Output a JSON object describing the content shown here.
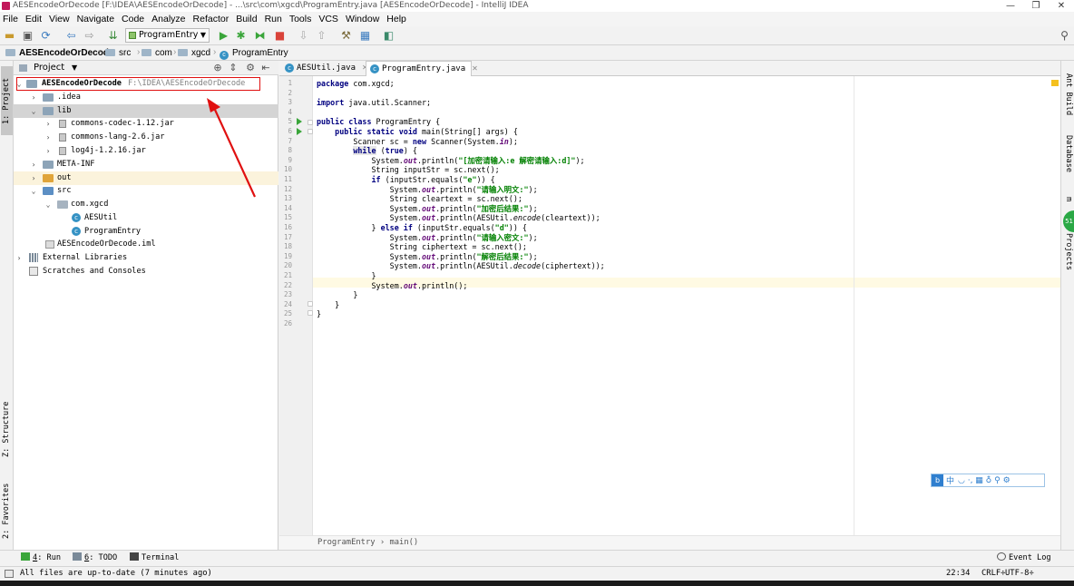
{
  "window": {
    "title": "AESEncodeOrDecode [F:\\IDEA\\AESEncodeOrDecode] - ...\\src\\com\\xgcd\\ProgramEntry.java [AESEncodeOrDecode] - IntelliJ IDEA",
    "minimize": "—",
    "maximize": "❐",
    "close": "✕"
  },
  "menu": [
    "File",
    "Edit",
    "View",
    "Navigate",
    "Code",
    "Analyze",
    "Refactor",
    "Build",
    "Run",
    "Tools",
    "VCS",
    "Window",
    "Help"
  ],
  "toolbar": {
    "run_config": "ProgramEntry"
  },
  "breadcrumbs": [
    "AESEncodeOrDecode",
    "src",
    "com",
    "xgcd",
    "ProgramEntry"
  ],
  "left_strip": {
    "project_tab": "1: Project",
    "structure_tab": "Z: Structure",
    "favorites_tab": "2: Favorites"
  },
  "right_strip": {
    "ant_tab": "Ant Build",
    "database_tab": "Database",
    "maven_tab": "m",
    "projects_tab": "Projects",
    "badge": "51"
  },
  "project_panel": {
    "title": "Project",
    "tree": [
      {
        "label": "AESEncodeOrDecode",
        "path": "F:\\IDEA\\AESEncodeOrDecode",
        "bold": true
      },
      {
        "label": ".idea"
      },
      {
        "label": "lib"
      },
      {
        "label": "commons-codec-1.12.jar"
      },
      {
        "label": "commons-lang-2.6.jar"
      },
      {
        "label": "log4j-1.2.16.jar"
      },
      {
        "label": "META-INF"
      },
      {
        "label": "out"
      },
      {
        "label": "src"
      },
      {
        "label": "com.xgcd"
      },
      {
        "label": "AESUtil"
      },
      {
        "label": "ProgramEntry"
      },
      {
        "label": "AESEncodeOrDecode.iml"
      },
      {
        "label": "External Libraries"
      },
      {
        "label": "Scratches and Consoles"
      }
    ]
  },
  "editor": {
    "tabs": [
      {
        "label": "AESUtil.java",
        "active": false
      },
      {
        "label": "ProgramEntry.java",
        "active": true
      }
    ],
    "line_numbers": [
      "1",
      "2",
      "3",
      "4",
      "5",
      "6",
      "7",
      "8",
      "9",
      "10",
      "11",
      "12",
      "13",
      "14",
      "15",
      "16",
      "17",
      "18",
      "19",
      "20",
      "21",
      "22",
      "23",
      "24",
      "25",
      "26"
    ],
    "breadcrumb": "ProgramEntry  › main()"
  },
  "ime_bar": {
    "logo": "b",
    "lang": "中",
    "icons": "◡ ·, ▦ ♁ ⚲ ⚙"
  },
  "bottom_tools": [
    {
      "num": "4",
      "label": ": Run"
    },
    {
      "num": "6",
      "label": ": TODO"
    },
    {
      "num": "",
      "label": "Terminal"
    },
    {
      "num": "",
      "label": "Event Log"
    }
  ],
  "status": {
    "message": "All files are up-to-date (7 minutes ago)",
    "position": "22:34",
    "line_sep": "CRLF÷",
    "encoding": "UTF-8÷"
  },
  "colors": {
    "keyword": "#000080",
    "string": "#008000",
    "field": "#660e7a",
    "annotation_red": "#e01010"
  }
}
